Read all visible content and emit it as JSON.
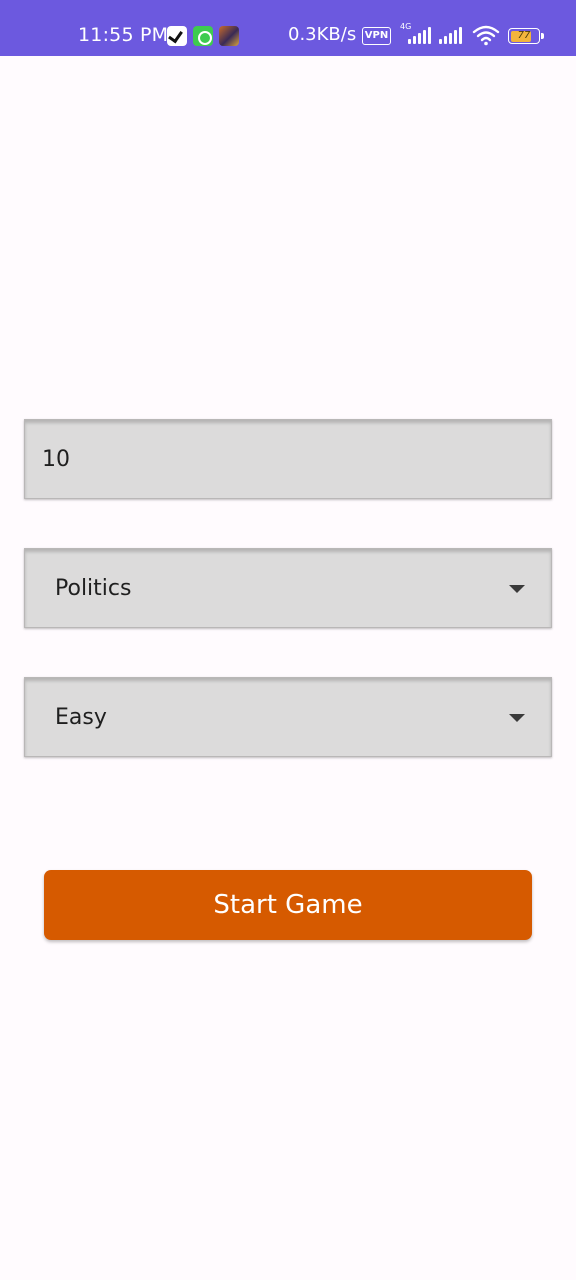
{
  "status_bar": {
    "time": "11:55 PM",
    "net_speed": "0.3KB/s",
    "vpn_label": "VPN",
    "network_type": "4G",
    "battery_level": "77",
    "background_color": "#6c59df",
    "icons": [
      "v-app-icon",
      "green-app-icon",
      "game-app-icon",
      "vpn-icon",
      "signal-icon",
      "wifi-icon",
      "battery-icon"
    ]
  },
  "form": {
    "question_count": {
      "value": "10"
    },
    "category": {
      "selected": "Politics"
    },
    "difficulty": {
      "selected": "Easy"
    }
  },
  "start_button": {
    "label": "Start Game",
    "color": "#d65a00"
  },
  "colors": {
    "field_background": "#dcdbdb",
    "page_background": "#fffbfe"
  }
}
